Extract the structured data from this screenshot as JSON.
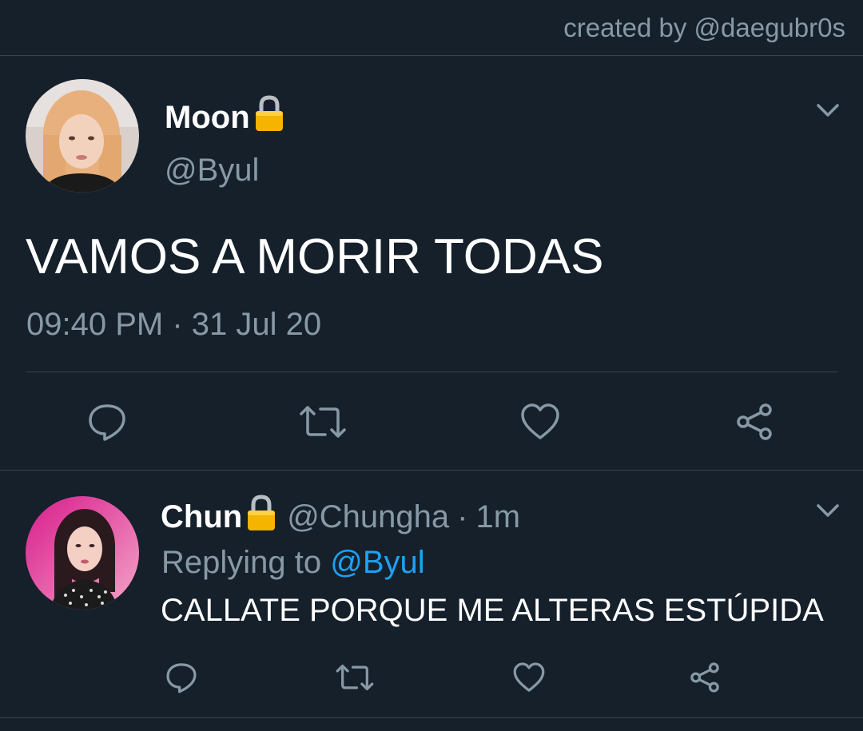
{
  "credit": "created by @daegubr0s",
  "main_tweet": {
    "display_name": "Moon",
    "handle": "@Byul",
    "text": "VAMOS A MORIR TODAS",
    "time": "09:40 PM",
    "separator": "·",
    "date": "31 Jul 20",
    "avatar": "avatar-moon",
    "protected_icon": "lock-icon"
  },
  "reply_tweet": {
    "display_name": "Chun",
    "handle": "@Chungha",
    "separator": "·",
    "age": "1m",
    "replying_prefix": "Replying to",
    "replying_to": "@Byul",
    "text": "CALLATE PORQUE ME ALTERAS ESTÚPIDA",
    "avatar": "avatar-chun",
    "protected_icon": "lock-icon"
  },
  "actions": [
    "reply-icon",
    "retweet-icon",
    "like-icon",
    "share-icon"
  ],
  "colors": {
    "background": "#15202b",
    "secondary_text": "#8899a6",
    "divider": "#38444d",
    "link": "#1da1f2",
    "lock": "#f5b400"
  }
}
